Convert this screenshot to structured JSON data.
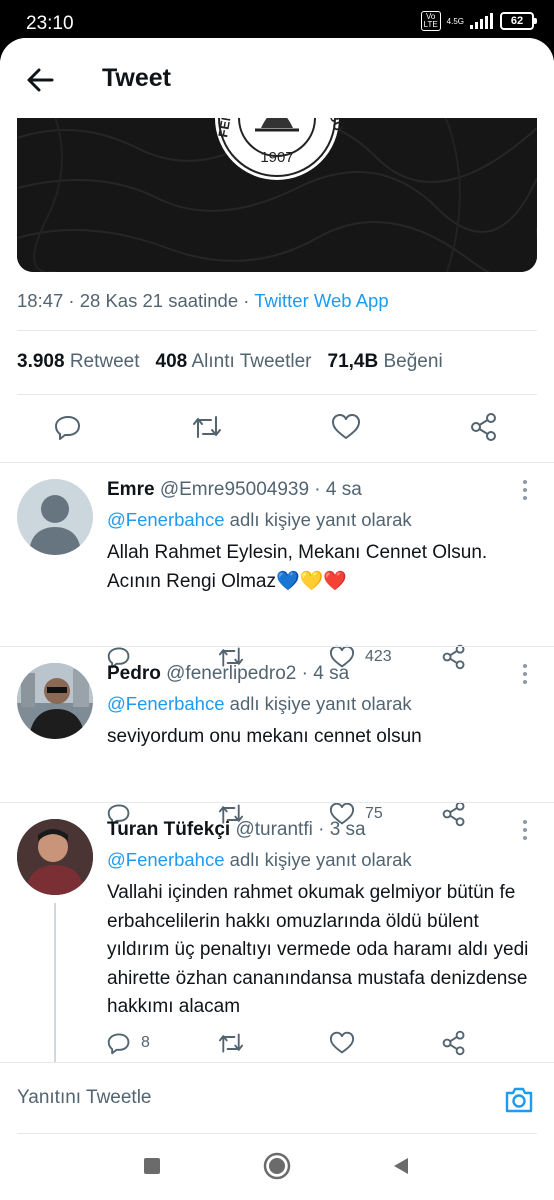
{
  "status_bar": {
    "time": "23:10",
    "volte_label": "Vo LTE",
    "network": "4.5G",
    "battery": "62"
  },
  "header": {
    "title": "Tweet"
  },
  "tweet": {
    "timestamp": "18:47 · 28 Kas 21 saatinde · ",
    "source": "Twitter Web App",
    "media_badge_year": "1907",
    "media_badge_text_left": "FENER",
    "media_badge_text_right": "LÜBÜ",
    "stats": {
      "retweets_count": "3.908",
      "retweets_label": "Retweet",
      "quotes_count": "408",
      "quotes_label": "Alıntı Tweetler",
      "likes_count": "71,4B",
      "likes_label": "Beğeni"
    }
  },
  "replies": [
    {
      "name": "Emre",
      "handle": "@Emre95004939",
      "time": " · 4 sa",
      "mention": "@Fenerbahce",
      "replying_suffix": " adlı kişiye yanıt olarak",
      "text": "Allah Rahmet Eylesin, Mekanı Cennet Olsun. Acının Rengi Olmaz💙💛❤️",
      "reply_count": "",
      "like_count": "423"
    },
    {
      "name": "Pedro",
      "handle": "@fenerlipedro2",
      "time": " · 4 sa",
      "mention": "@Fenerbahce",
      "replying_suffix": " adlı kişiye yanıt olarak",
      "text": "seviyordum onu mekanı cennet olsun",
      "reply_count": "",
      "like_count": "75"
    },
    {
      "name": "Turan Tüfekçi",
      "handle": "@turantfi",
      "time": " · 3 sa",
      "mention": "@Fenerbahce",
      "replying_suffix": " adlı kişiye yanıt olarak",
      "text": "Vallahi içinden rahmet okumak gelmiyor bütün fe erbahcelilerin hakkı omuzlarında öldü bülent yıldırım üç penaltıyı vermede oda haramı aldı yedi ahirette özhan cananındansa mustafa denizdense hakkımı alacam",
      "reply_count": "8",
      "like_count": ""
    }
  ],
  "compose": {
    "placeholder": "Yanıtını Tweetle"
  },
  "colors": {
    "accent": "#1d9bf0",
    "secondary_text": "#536471",
    "like_red": "#e0245e"
  },
  "icons": [
    "back-arrow-icon",
    "reply-icon",
    "retweet-icon",
    "like-icon",
    "share-icon",
    "more-icon",
    "camera-icon",
    "nav-recents-icon",
    "nav-home-icon",
    "nav-back-icon"
  ]
}
